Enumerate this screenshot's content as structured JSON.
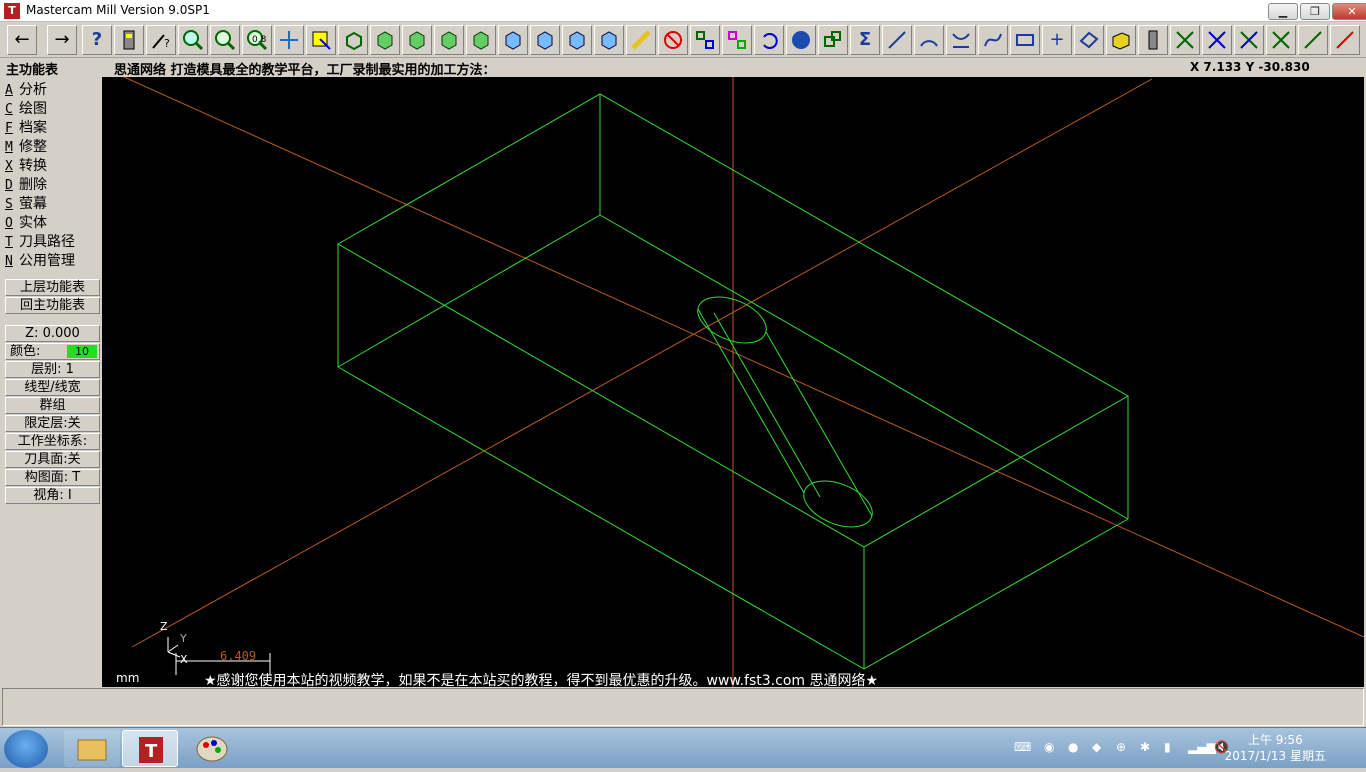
{
  "window": {
    "title": "Mastercam Mill Version 9.0SP1",
    "minimize": "▁",
    "restore": "❐",
    "close": "✕"
  },
  "statusline": {
    "menu_title": "主功能表",
    "prompt": "思通网络  打造模具最全的教学平台，工厂录制最实用的加工方法：",
    "coords": "X 7.133  Y -30.830"
  },
  "menu": [
    {
      "key": "A",
      "label": "分析"
    },
    {
      "key": "C",
      "label": "绘图"
    },
    {
      "key": "F",
      "label": "档案"
    },
    {
      "key": "M",
      "label": "修整"
    },
    {
      "key": "X",
      "label": "转换"
    },
    {
      "key": "D",
      "label": "删除"
    },
    {
      "key": "S",
      "label": "萤幕"
    },
    {
      "key": "O",
      "label": "实体"
    },
    {
      "key": "T",
      "label": "刀具路径"
    },
    {
      "key": "N",
      "label": "公用管理"
    }
  ],
  "nav": {
    "up": "上层功能表",
    "main": "回主功能表"
  },
  "params": {
    "z": "Z:  0.000",
    "color_label": "颜色:",
    "color_value": "10",
    "layer": "层别:  1",
    "linetype": "线型/线宽",
    "group": "群组",
    "mask": "限定层:关",
    "wcs": "工作坐标系:",
    "toolplane": "刀具面:关",
    "cplane": "构图面: T",
    "gview": "视角:  I"
  },
  "viewport": {
    "units": "mm",
    "axis_z": "Z",
    "axis_y": "Y",
    "axis_x": "X",
    "scale_value": "6.409",
    "footer": "★感谢您使用本站的视频教学，如果不是在本站买的教程，得不到最优惠的升级。www.fst3.com  思通网络★"
  },
  "taskbar": {
    "time": "上午 9:56",
    "date": "2017/1/13 星期五"
  },
  "colors": {
    "wireframe": "#33dd33",
    "axis": "#b85a1e",
    "viewport_bg": "#000000"
  }
}
